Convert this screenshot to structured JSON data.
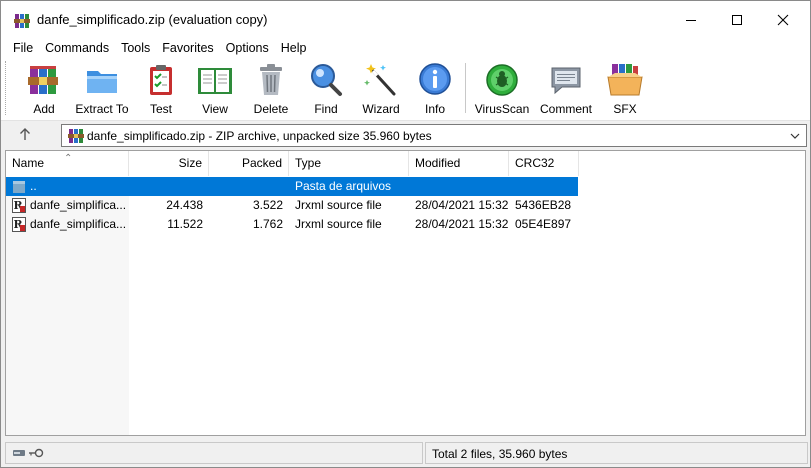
{
  "window": {
    "title": "danfe_simplificado.zip (evaluation copy)"
  },
  "menu": {
    "items": [
      "File",
      "Commands",
      "Tools",
      "Favorites",
      "Options",
      "Help"
    ]
  },
  "toolbar": {
    "buttons": [
      {
        "label": "Add",
        "icon": "add-archive-icon"
      },
      {
        "label": "Extract To",
        "icon": "extract-folder-icon"
      },
      {
        "label": "Test",
        "icon": "test-clipboard-icon"
      },
      {
        "label": "View",
        "icon": "view-book-icon"
      },
      {
        "label": "Delete",
        "icon": "trash-icon"
      },
      {
        "label": "Find",
        "icon": "magnifier-icon"
      },
      {
        "label": "Wizard",
        "icon": "magic-wand-icon"
      },
      {
        "label": "Info",
        "icon": "info-icon"
      },
      {
        "label": "VirusScan",
        "icon": "virus-scan-icon"
      },
      {
        "label": "Comment",
        "icon": "comment-icon"
      },
      {
        "label": "SFX",
        "icon": "sfx-box-icon"
      }
    ]
  },
  "address": {
    "text": "danfe_simplificado.zip - ZIP archive, unpacked size 35.960 bytes"
  },
  "list": {
    "columns": [
      "Name",
      "Size",
      "Packed",
      "Type",
      "Modified",
      "CRC32"
    ],
    "rows": [
      {
        "name": "..",
        "size": "",
        "packed": "",
        "type": "Pasta de arquivos",
        "modified": "",
        "crc": ""
      },
      {
        "name": "danfe_simplifica...",
        "size": "24.438",
        "packed": "3.522",
        "type": "Jrxml source file",
        "modified": "28/04/2021 15:32",
        "crc": "5436EB28"
      },
      {
        "name": "danfe_simplifica...",
        "size": "11.522",
        "packed": "1.762",
        "type": "Jrxml source file",
        "modified": "28/04/2021 15:32",
        "crc": "05E4E897"
      }
    ]
  },
  "status": {
    "summary": "Total 2 files, 35.960 bytes"
  },
  "colors": {
    "selection": "#0078d7",
    "window_bg": "#f0f0f0"
  }
}
